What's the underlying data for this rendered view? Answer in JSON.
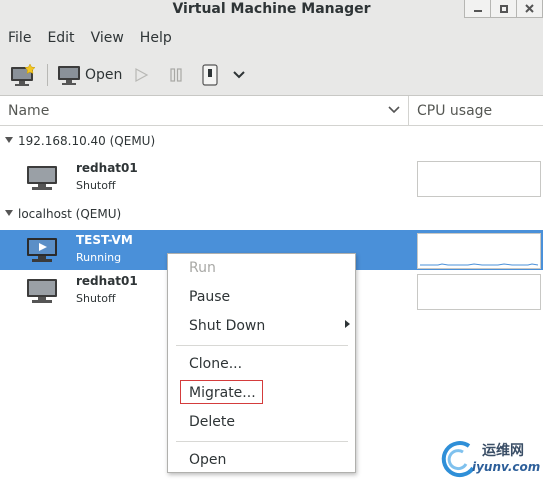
{
  "window": {
    "title": "Virtual Machine Manager"
  },
  "menubar": [
    "File",
    "Edit",
    "View",
    "Help"
  ],
  "toolbar": {
    "open_label": "Open"
  },
  "columns": {
    "name": "Name",
    "cpu": "CPU usage"
  },
  "groups": [
    {
      "label": "192.168.10.40 (QEMU)"
    },
    {
      "label": "localhost (QEMU)"
    }
  ],
  "vms": [
    {
      "name": "redhat01",
      "status": "Shutoff"
    },
    {
      "name": "TEST-VM",
      "status": "Running"
    },
    {
      "name": "redhat01",
      "status": "Shutoff"
    }
  ],
  "context_menu": {
    "run": "Run",
    "pause": "Pause",
    "shutdown": "Shut Down",
    "clone": "Clone...",
    "migrate": "Migrate...",
    "delete": "Delete",
    "open": "Open"
  },
  "watermark": {
    "brand_cn": "运维网",
    "domain": "iyunv.com"
  },
  "colors": {
    "selection": "#4a90d9",
    "highlight_box": "#d43c3c"
  }
}
